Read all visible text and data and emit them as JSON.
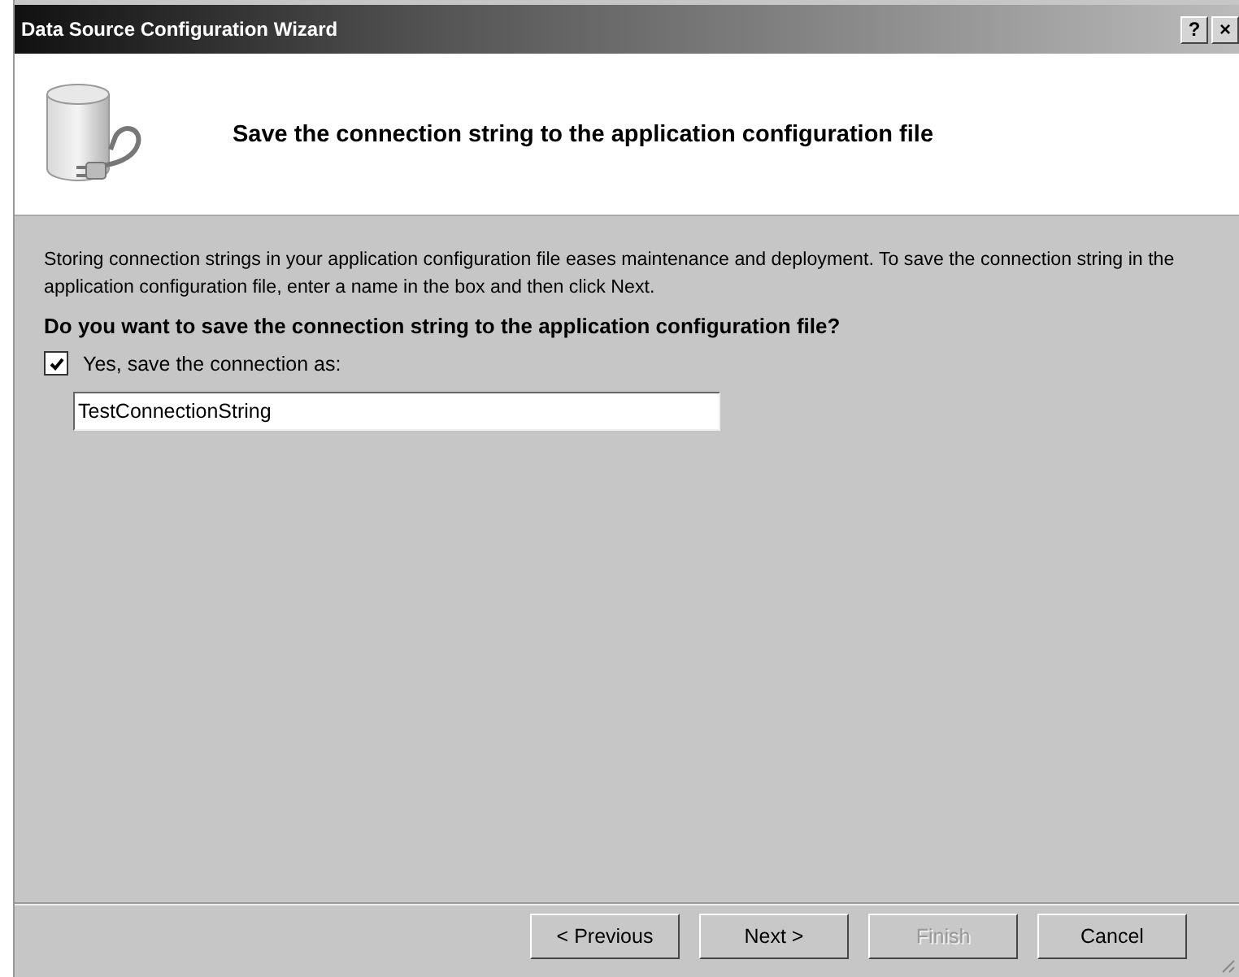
{
  "window": {
    "title": "Data Source Configuration Wizard",
    "title_buttons": [
      "?",
      "×"
    ]
  },
  "header": {
    "title": "Save the connection string to the application configuration file"
  },
  "description": "Storing connection strings in your application configuration file eases maintenance and deployment. To save the connection string in the application configuration file, enter a name in the box and then click Next.",
  "question": "Do you want to save the connection string to the application configuration file?",
  "save_checkbox": {
    "label": "Yes, save the connection as:",
    "checked": true
  },
  "name_field": {
    "value": "TestConnectionString"
  },
  "buttons": [
    {
      "label": "< Previous",
      "disabled": false
    },
    {
      "label": "Next >",
      "disabled": false
    },
    {
      "label": "Finish",
      "disabled": true
    },
    {
      "label": "Cancel",
      "disabled": false
    }
  ]
}
